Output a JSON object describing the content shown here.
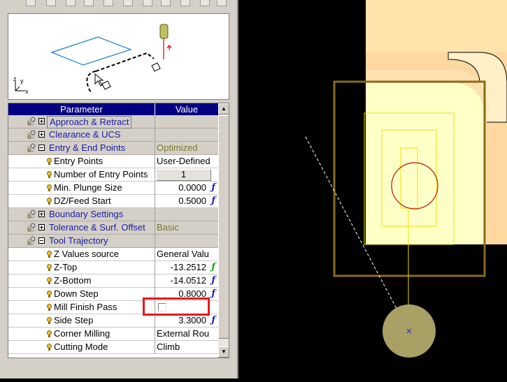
{
  "grid": {
    "header": {
      "parameter": "Parameter",
      "value": "Value"
    },
    "rows": [
      {
        "kind": "group",
        "label": "Approach & Retract",
        "expanded": false,
        "value": ""
      },
      {
        "kind": "group",
        "label": "Clearance & UCS",
        "expanded": false,
        "value": ""
      },
      {
        "kind": "group",
        "label": "Entry & End Points",
        "expanded": true,
        "value": "Optimized"
      },
      {
        "kind": "param",
        "label": "Entry Points",
        "value": "User-Defined"
      },
      {
        "kind": "param",
        "label": "Number of Entry Points",
        "value": "1"
      },
      {
        "kind": "param",
        "label": "Min. Plunge Size",
        "value": "0.0000"
      },
      {
        "kind": "param",
        "label": "DZ/Feed Start",
        "value": "0.5000"
      },
      {
        "kind": "group",
        "label": "Boundary Settings",
        "expanded": false,
        "value": ""
      },
      {
        "kind": "group",
        "label": "Tolerance & Surf. Offset",
        "expanded": false,
        "value": "Basic"
      },
      {
        "kind": "group",
        "label": "Tool Trajectory",
        "expanded": true,
        "value": ""
      },
      {
        "kind": "param",
        "label": "Z Values source",
        "value": "General Valu"
      },
      {
        "kind": "param",
        "label": "Z-Top",
        "value": "-13.2512"
      },
      {
        "kind": "param",
        "label": "Z-Bottom",
        "value": "-14.0512"
      },
      {
        "kind": "param",
        "label": "Down Step",
        "value": "0.8000"
      },
      {
        "kind": "param",
        "label": "Mill Finish Pass",
        "value": ""
      },
      {
        "kind": "param",
        "label": "Side Step",
        "value": "3.3000"
      },
      {
        "kind": "param",
        "label": "Corner Milling",
        "value": "External Rou"
      },
      {
        "kind": "param",
        "label": "Cutting Mode",
        "value": "Climb"
      }
    ]
  },
  "mill_finish_pass": {
    "checked": false
  },
  "preview": {
    "axis_z": "z",
    "axis_y": "y",
    "axis_x": "x"
  },
  "colors": {
    "header_bg": "#000080",
    "group_label": "#1a1aaa",
    "group_value": "#7a7a28",
    "function_icon": "#2020c0",
    "function_icon_alt": "#10a010",
    "highlight": "#e81818",
    "part_fill": "#ffffc8",
    "tool_fill": "#a8a064"
  },
  "icons": {
    "group": "settings-group-icon",
    "param": "bulb-icon",
    "function": "function-f-icon"
  }
}
